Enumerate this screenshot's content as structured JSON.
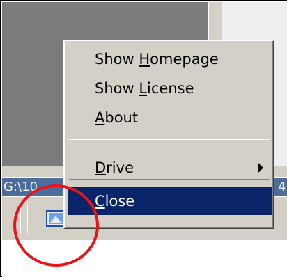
{
  "status_strip": {
    "left_text": "G:\\10",
    "right_text": "4"
  },
  "context_menu": {
    "items": [
      {
        "pre": "Show ",
        "mnemonic": "H",
        "post": "omepage",
        "submenu": false,
        "selected": false
      },
      {
        "pre": "Show ",
        "mnemonic": "L",
        "post": "icense",
        "submenu": false,
        "selected": false
      },
      {
        "pre": "",
        "mnemonic": "A",
        "post": "bout",
        "submenu": false,
        "selected": false
      },
      {
        "pre": "",
        "mnemonic": "D",
        "post": "rive",
        "submenu": true,
        "selected": false
      },
      {
        "pre": "",
        "mnemonic": "C",
        "post": "lose",
        "submenu": false,
        "selected": true
      }
    ]
  },
  "tray_icons": [
    "app-tray-icon",
    "drive-tray-icon",
    "orange-circle-tray-icon",
    "zonealarm-tray-icon",
    "red-one-tray-icon",
    "shield-tray-icon",
    "network-tray-icon",
    "globe-tray-icon"
  ],
  "colors": {
    "menu_bg": "#d4d0c8",
    "selection_bg": "#0a246a",
    "highlight_circle": "#e81418",
    "status_strip": "#4a6d9c"
  }
}
